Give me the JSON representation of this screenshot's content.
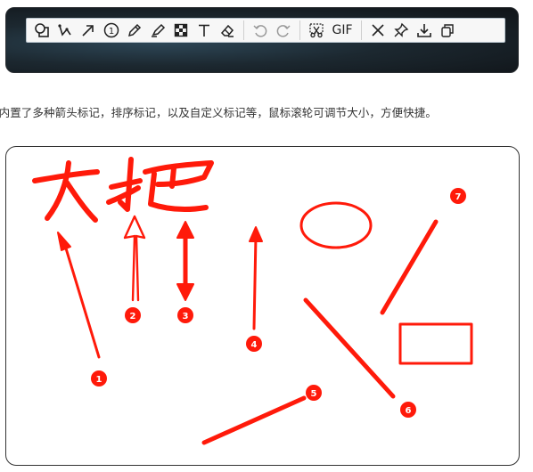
{
  "toolbar": {
    "items": [
      {
        "name": "shape-icon",
        "label": "shape"
      },
      {
        "name": "polyline-icon",
        "label": "polyline"
      },
      {
        "name": "arrow-icon",
        "label": "arrow"
      },
      {
        "name": "number-marker-icon",
        "label": "1"
      },
      {
        "name": "pencil-icon",
        "label": "pencil"
      },
      {
        "name": "highlighter-icon",
        "label": "highlighter"
      },
      {
        "name": "mosaic-icon",
        "label": "mosaic"
      },
      {
        "name": "text-icon",
        "label": "T"
      },
      {
        "name": "eraser-icon",
        "label": "eraser"
      },
      {
        "name": "undo-icon",
        "label": "undo"
      },
      {
        "name": "redo-icon",
        "label": "redo"
      },
      {
        "name": "cut-icon",
        "label": "cut"
      },
      {
        "name": "gif-button",
        "label": "GIF"
      },
      {
        "name": "close-icon",
        "label": "close"
      },
      {
        "name": "pin-icon",
        "label": "pin"
      },
      {
        "name": "download-icon",
        "label": "download"
      },
      {
        "name": "copy-icon",
        "label": "copy"
      }
    ]
  },
  "description": "件内置了多种箭头标记，排序标记，以及自定义标记等，鼠标滚轮可调节大小，方便快捷。",
  "canvas": {
    "handwriting": "大把",
    "annotation_color": "#ff1a0a",
    "markers": [
      "1",
      "2",
      "3",
      "4",
      "5",
      "6",
      "7"
    ]
  }
}
